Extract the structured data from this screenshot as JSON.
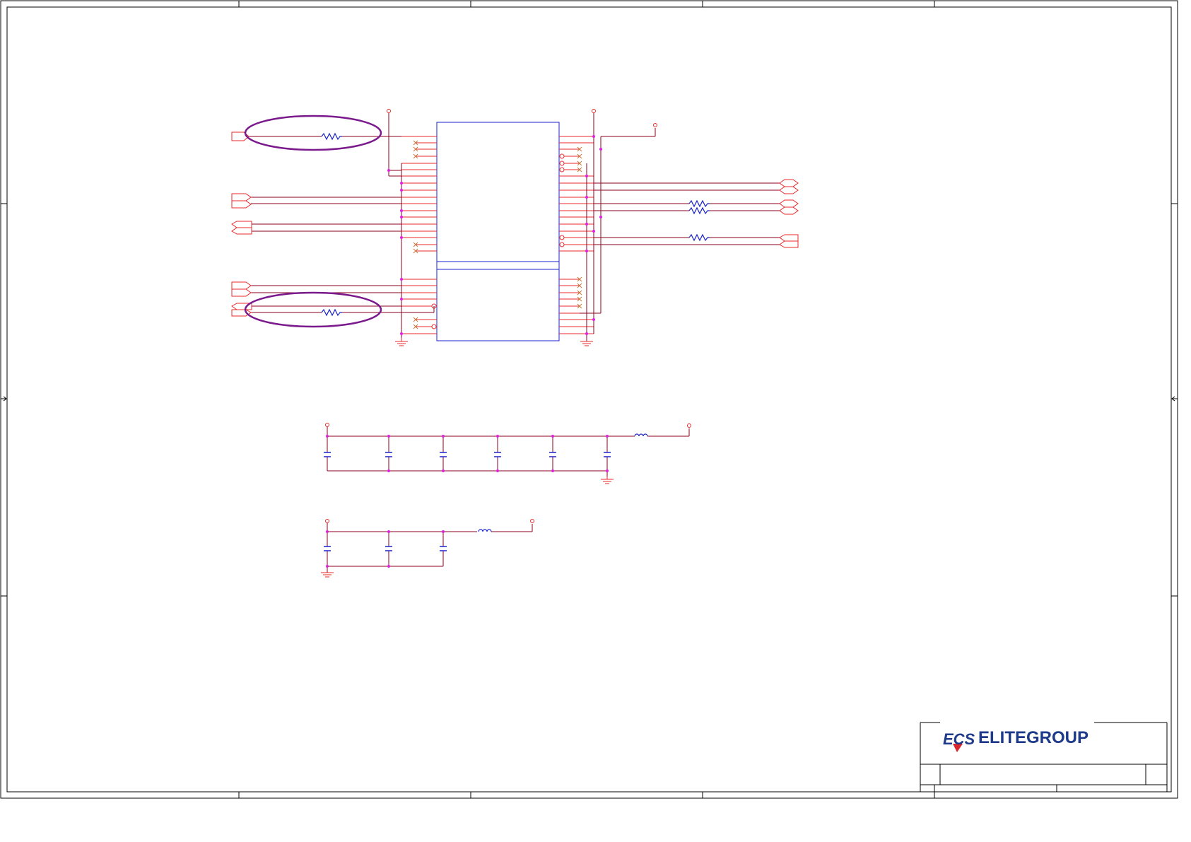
{
  "title_block": {
    "company_mark": "ECS",
    "company_name": "ELITEGROUP"
  },
  "colors": {
    "border": "#000000",
    "wire": "#8b0020",
    "pin": "#e8292b",
    "junction": "#e020e0",
    "part": "#1a22cc",
    "highlight": "#7a1a8c",
    "logo_blue": "#1e3a8a",
    "logo_red": "#d9252c"
  }
}
